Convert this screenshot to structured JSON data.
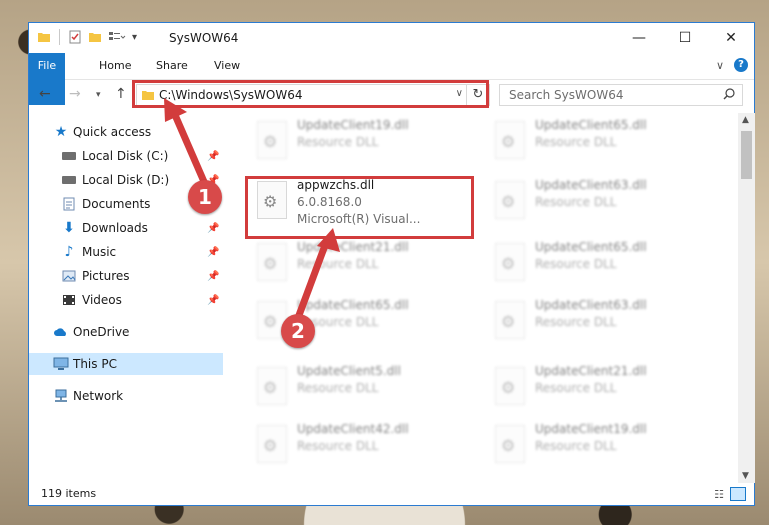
{
  "window": {
    "title": "SysWOW64",
    "controls": {
      "minimize": "—",
      "maximize": "☐",
      "close": "✕"
    }
  },
  "ribbon": {
    "tabs": [
      "File",
      "Home",
      "Share",
      "View"
    ],
    "help": "?"
  },
  "address_bar": {
    "path": "C:\\Windows\\SysWOW64",
    "dropdown": "∨",
    "refresh": "↻"
  },
  "search": {
    "placeholder": "Search SysWOW64",
    "icon": "search-icon"
  },
  "sidebar": {
    "items": [
      {
        "label": "Quick access",
        "icon": "star-icon",
        "pinned": false
      },
      {
        "label": "Local Disk (C:)",
        "icon": "drive-icon",
        "pinned": true
      },
      {
        "label": "Local Disk (D:)",
        "icon": "drive-icon",
        "pinned": true
      },
      {
        "label": "Documents",
        "icon": "documents-icon",
        "pinned": true
      },
      {
        "label": "Downloads",
        "icon": "download-icon",
        "pinned": true
      },
      {
        "label": "Music",
        "icon": "music-icon",
        "pinned": true
      },
      {
        "label": "Pictures",
        "icon": "pictures-icon",
        "pinned": true
      },
      {
        "label": "Videos",
        "icon": "videos-icon",
        "pinned": true
      },
      {
        "label": "OneDrive",
        "icon": "cloud-icon",
        "pinned": false
      },
      {
        "label": "This PC",
        "icon": "computer-icon",
        "pinned": false,
        "selected": true
      },
      {
        "label": "Network",
        "icon": "network-icon",
        "pinned": false
      }
    ]
  },
  "files": {
    "left": [
      {
        "name": "UpdateClient19.dll",
        "desc": "Resource DLL"
      },
      {
        "name": "appwzchs.dll",
        "desc": "6.0.8168.0",
        "desc2": "Microsoft(R) Visual...",
        "highlighted": true
      },
      {
        "name": "UpdateClient21.dll",
        "desc": "Resource DLL"
      },
      {
        "name": "UpdateClient65.dll",
        "desc": "Resource DLL"
      },
      {
        "name": "UpdateClient5.dll",
        "desc": "Resource DLL"
      },
      {
        "name": "UpdateClient42.dll",
        "desc": "Resource DLL"
      }
    ],
    "right": [
      {
        "name": "UpdateClient65.dll",
        "desc": "Resource DLL"
      },
      {
        "name": "UpdateClient63.dll",
        "desc": "Resource DLL"
      },
      {
        "name": "UpdateClient65.dll",
        "desc": "Resource DLL"
      },
      {
        "name": "UpdateClient63.dll",
        "desc": "Resource DLL"
      },
      {
        "name": "UpdateClient21.dll",
        "desc": "Resource DLL"
      },
      {
        "name": "UpdateClient19.dll",
        "desc": "Resource DLL"
      }
    ]
  },
  "status": {
    "item_count": "119 items"
  },
  "annotations": {
    "badge1": "1",
    "badge2": "2",
    "color": "#d23c3c"
  }
}
